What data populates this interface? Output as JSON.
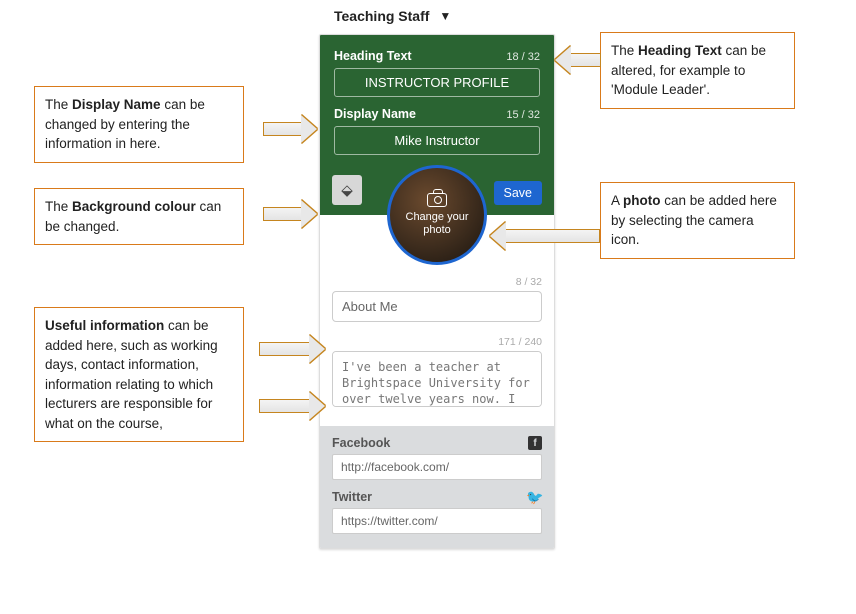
{
  "dropdown": {
    "label": "Teaching Staff"
  },
  "green": {
    "heading_label": "Heading Text",
    "heading_count": "18 / 32",
    "heading_value": "INSTRUCTOR PROFILE",
    "display_label": "Display Name",
    "display_count": "15 / 32",
    "display_value": "Mike Instructor",
    "save": "Save"
  },
  "avatar": {
    "line1": "Change your",
    "line2": "photo"
  },
  "about": {
    "count": "8 / 32",
    "value": "About Me",
    "bio_count": "171 / 240",
    "bio_value": "I've been a teacher at Brightspace University for over twelve years now. I am passionate about online"
  },
  "social": {
    "fb_label": "Facebook",
    "fb_value": "http://facebook.com/",
    "tw_label": "Twitter",
    "tw_value": "https://twitter.com/"
  },
  "ann": {
    "heading": "The <b>Heading Text</b> can be altered, for example to 'Module Leader'.",
    "display": "The <b>Display Name</b> can be changed by entering the information in here.",
    "bg": "The <b>Background colour</b> can be changed.",
    "photo": "A <b>photo</b> can be added here by selecting the camera icon.",
    "useful": "<b>Useful information</b> can be added here, such as working days, contact information, information relating to which lecturers are responsible for what on the course,"
  }
}
